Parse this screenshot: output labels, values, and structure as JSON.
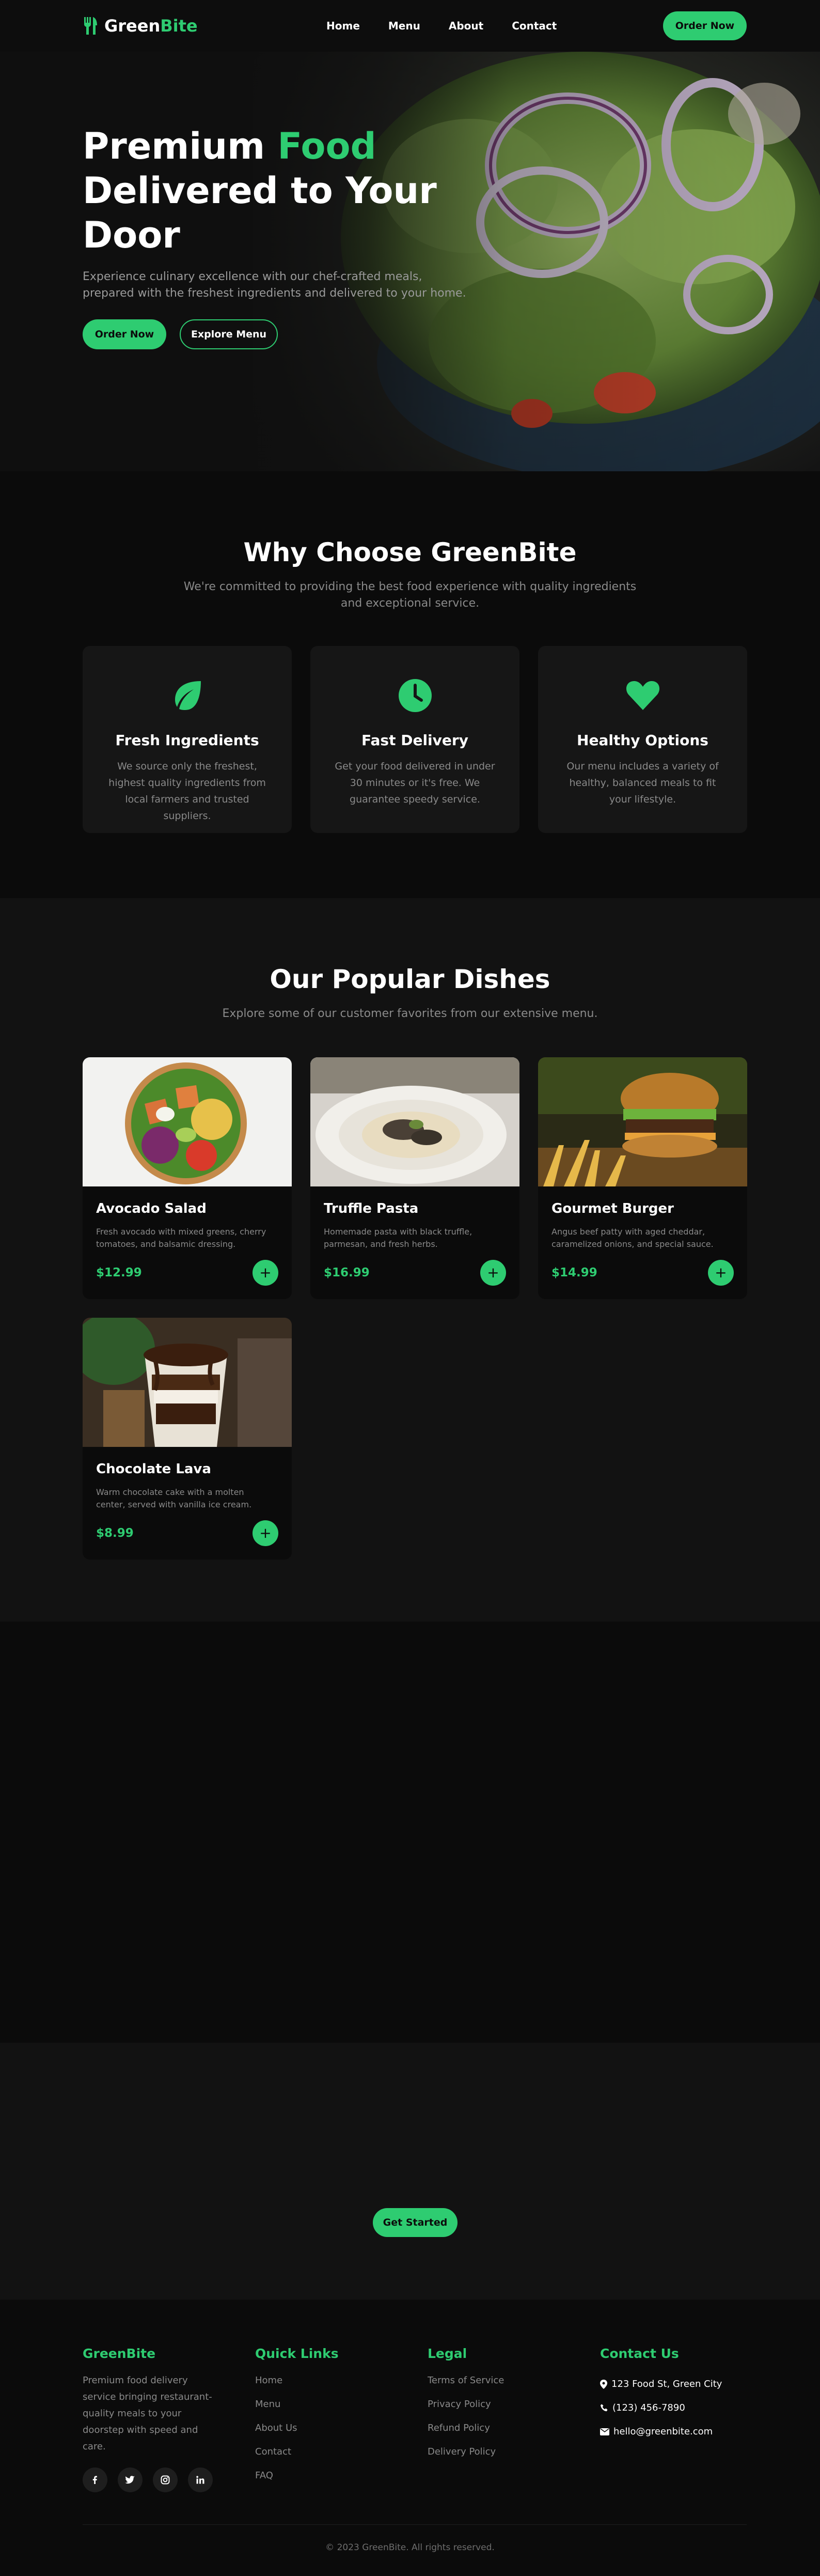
{
  "nav": {
    "brand_part1": "Green",
    "brand_part2": "Bite",
    "links": [
      "Home",
      "Menu",
      "About",
      "Contact"
    ],
    "cta": "Order Now"
  },
  "hero": {
    "title_line1_a": "Premium ",
    "title_line1_b": "Food",
    "title_line2": "Delivered to Your",
    "title_line3": "Door",
    "subtitle": "Experience culinary excellence with our chef-crafted meals, prepared with the freshest ingredients and delivered to your home.",
    "primary_button": "Order Now",
    "secondary_button": "Explore Menu"
  },
  "why": {
    "title": "Why Choose GreenBite",
    "subtitle": "We're committed to providing the best food experience with quality ingredients and exceptional service.",
    "features": [
      {
        "icon": "leaf-icon",
        "title": "Fresh Ingredients",
        "text": "We source only the freshest, highest quality ingredients from local farmers and trusted suppliers."
      },
      {
        "icon": "clock-icon",
        "title": "Fast Delivery",
        "text": "Get your food delivered in under 30 minutes or it's free. We guarantee speedy service."
      },
      {
        "icon": "heart-icon",
        "title": "Healthy Options",
        "text": "Our menu includes a variety of healthy, balanced meals to fit your lifestyle."
      }
    ]
  },
  "dishes": {
    "title": "Our Popular Dishes",
    "subtitle": "Explore some of our customer favorites from our extensive menu.",
    "items": [
      {
        "name": "Avocado Salad",
        "desc": "Fresh avocado with mixed greens, cherry tomatoes, and balsamic dressing.",
        "price": "$12.99",
        "add": "+"
      },
      {
        "name": "Truffle Pasta",
        "desc": "Homemade pasta with black truffle, parmesan, and fresh herbs.",
        "price": "$16.99",
        "add": "+"
      },
      {
        "name": "Gourmet Burger",
        "desc": "Angus beef patty with aged cheddar, caramelized onions, and special sauce.",
        "price": "$14.99",
        "add": "+"
      },
      {
        "name": "Chocolate Lava",
        "desc": "Warm chocolate cake with a molten center, served with vanilla ice cream.",
        "price": "$8.99",
        "add": "+"
      }
    ]
  },
  "cta": {
    "button": "Get Started"
  },
  "footer": {
    "brand": "GreenBite",
    "about": "Premium food delivery service bringing restaurant-quality meals to your doorstep with speed and care.",
    "socials": [
      "f",
      "🐦",
      "◎",
      "in"
    ],
    "quick_title": "Quick Links",
    "quick_links": [
      "Home",
      "Menu",
      "About Us",
      "Contact",
      "FAQ"
    ],
    "legal_title": "Legal",
    "legal_links": [
      "Terms of Service",
      "Privacy Policy",
      "Refund Policy",
      "Delivery Policy"
    ],
    "contact_title": "Contact Us",
    "address": "123 Food St, Green City",
    "phone": "(123) 456-7890",
    "email": "hello@greenbite.com",
    "copyright": "© 2023 GreenBite. All rights reserved."
  },
  "colors": {
    "accent": "#2ecc71",
    "background": "#0b0b0b",
    "card": "#161616"
  }
}
